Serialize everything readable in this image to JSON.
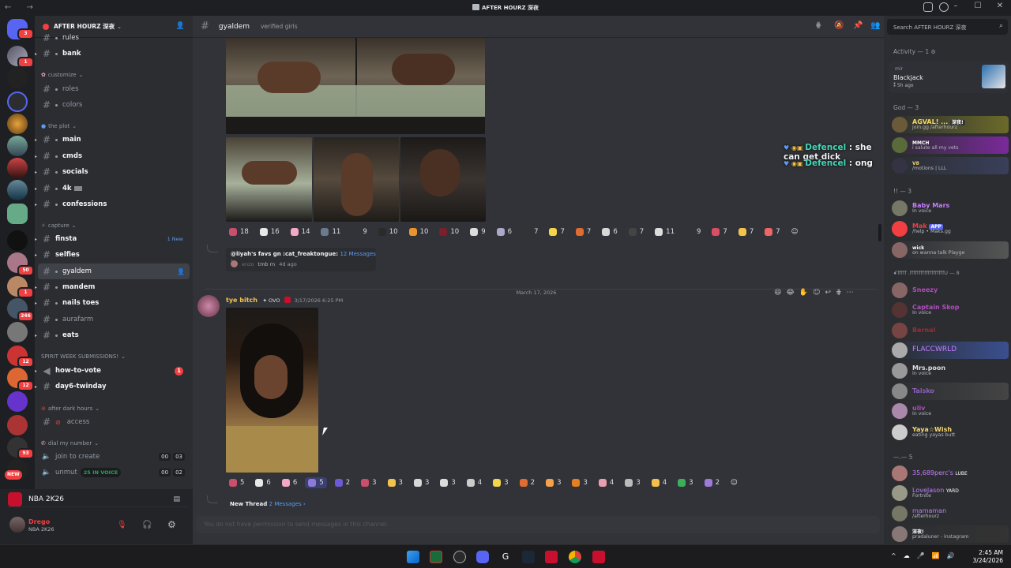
{
  "window": {
    "title": "AFTER HOURZ 深夜"
  },
  "server": {
    "name": "AFTER HOURZ 深夜"
  },
  "search": {
    "placeholder": "Search AFTER HOURZ 深夜"
  },
  "header": {
    "channel": "gyaldem",
    "topic": "verified girls"
  },
  "guild_badges": [
    "3",
    "1",
    "50",
    "1",
    "12",
    "246",
    "12",
    "1",
    "93",
    "1",
    "NEW"
  ],
  "sidebar": {
    "top_partial": "rules",
    "bank": "bank",
    "cat_customize": "customize",
    "roles": "roles",
    "colors": "colors",
    "cat_plot": "the plot",
    "main": "main",
    "cmds": "cmds",
    "socials": "socials",
    "k4": "4k",
    "confessions": "confessions",
    "cat_capture": "capture",
    "finsta": "finsta",
    "finsta_new": "1 New",
    "selfies": "selfies",
    "gyaldem": "gyaldem",
    "mandem": "mandem",
    "nailstoes": "nails toes",
    "aurafarm": "aurafarm",
    "eats": "eats",
    "cat_spirit": "SPIRIT WEEK SUBMISSIONS!",
    "howtovote": "how-to-vote",
    "howtovote_badge": "1",
    "day6": "day6-twinday",
    "cat_afterdark": "after dark hours",
    "access": "access",
    "cat_dial": "dial my number",
    "join": "join to create",
    "join_n1": "00",
    "join_n2": "03",
    "unmute": "unmut",
    "invoice_pill": "25 IN VOICE",
    "unmute_n1": "00",
    "unmute_n2": "02"
  },
  "activity": {
    "game": "NBA 2K26"
  },
  "user": {
    "name": "Drego",
    "status": "NBA 2K26"
  },
  "overlay": [
    {
      "name": "Defencel",
      "text": ": she can get dick"
    },
    {
      "name": "Defencel",
      "text": ": ong"
    }
  ],
  "reactions1": [
    {
      "n": "18",
      "c": "#c94f6d"
    },
    {
      "n": "16",
      "c": "#e8e8e8"
    },
    {
      "n": "14",
      "c": "#f4a7c6"
    },
    {
      "n": "11",
      "c": "#6b7a8f"
    },
    {
      "n": "9",
      "c": "#313338"
    },
    {
      "n": "10",
      "c": "#2b2b2b"
    },
    {
      "n": "10",
      "c": "#e8952e"
    },
    {
      "n": "10",
      "c": "#7a1f2b"
    },
    {
      "n": "9",
      "c": "#dcdcdc"
    },
    {
      "n": "6",
      "c": "#a9a9c9"
    },
    {
      "n": "7",
      "c": "#333"
    },
    {
      "n": "7",
      "c": "#f2d54a"
    },
    {
      "n": "7",
      "c": "#e06c2f"
    },
    {
      "n": "6",
      "c": "#d8d8d8"
    },
    {
      "n": "7",
      "c": "#444"
    },
    {
      "n": "11",
      "c": "#ddd"
    },
    {
      "n": "9",
      "c": "#313338"
    },
    {
      "n": "7",
      "c": "#d94e64"
    },
    {
      "n": "7",
      "c": "#f3c24a"
    },
    {
      "n": "7",
      "c": "#e66"
    }
  ],
  "reactions1_prefix": {
    "n18": "18"
  },
  "thread1": {
    "title": "@liyah's favs gn :cat_freaktongue:",
    "count": "12 Messages ›",
    "preview_user": "enzo",
    "preview_text": "tmb rn",
    "time": "4d ago"
  },
  "divider": "March 17, 2026",
  "message2": {
    "author": "tye bitch",
    "tag": "OVO",
    "timestamp": "3/17/2026 6:25 PM"
  },
  "reactions2": [
    {
      "n": "5",
      "c": "#c94f6d",
      "mine": false
    },
    {
      "n": "6",
      "c": "#e8e8e8",
      "mine": false
    },
    {
      "n": "6",
      "c": "#f4a7c6",
      "mine": false
    },
    {
      "n": "5",
      "c": "#8d7ad9",
      "mine": true
    },
    {
      "n": "2",
      "c": "#6a5ad9",
      "mine": false
    },
    {
      "n": "3",
      "c": "#c94f6d",
      "mine": false
    },
    {
      "n": "3",
      "c": "#f3c24a",
      "mine": false
    },
    {
      "n": "3",
      "c": "#d8d8d8",
      "mine": false
    },
    {
      "n": "3",
      "c": "#dcdcdc",
      "mine": false
    },
    {
      "n": "4",
      "c": "#ccc",
      "mine": false
    },
    {
      "n": "3",
      "c": "#f2d54a",
      "mine": false
    },
    {
      "n": "2",
      "c": "#e06c2f",
      "mine": false
    },
    {
      "n": "3",
      "c": "#f3a14a",
      "mine": false
    },
    {
      "n": "3",
      "c": "#e67e22",
      "mine": false
    },
    {
      "n": "4",
      "c": "#e8a0b0",
      "mine": false
    },
    {
      "n": "3",
      "c": "#bbb",
      "mine": false
    },
    {
      "n": "4",
      "c": "#f3c24a",
      "mine": false
    },
    {
      "n": "3",
      "c": "#3fae5a",
      "mine": false
    },
    {
      "n": "2",
      "c": "#a07ad9",
      "mine": false
    }
  ],
  "thread2": {
    "title": "New Thread",
    "count": "2 Messages ›"
  },
  "composer": {
    "notice": "You do not have permission to send messages in this channel."
  },
  "members": {
    "activity_head": "Activity — 1",
    "activity_user": "mir",
    "activity_game": "Blackjack",
    "activity_time": "5h ago",
    "god_head": "God — 3",
    "god": [
      {
        "name": "AGVAL! ...",
        "status": "join.gg /afterhourz",
        "color": "#f5d76e",
        "tag": "深夜!"
      },
      {
        "name": "",
        "status": "i salute all my vets",
        "color": "#fff",
        "tag": "MMCH"
      },
      {
        "name": "",
        "status": "/motions | LLL",
        "color": "#9aa",
        "tag": "V8"
      }
    ],
    "ii_head": "!! — 3",
    "ii": [
      {
        "name": "Baby Mars",
        "status": "In voice",
        "color": "#c77dff",
        "tag": ""
      },
      {
        "name": "Mak",
        "status": "/help • Maks.gg",
        "color": "#f23f42",
        "tag": "APP"
      },
      {
        "name": "",
        "status": "on wanna talk  Playge",
        "color": "#9aa",
        "tag": "wick"
      }
    ],
    "sq_head": "ꗃ𝖿𝖿𝖿𝖿𝖿  .𝖿𝖿𝖿𝖿𝖿𝖿𝖿𝖿𝖿𝖿𝖿𝖿𝖿𝖿𝖿𝖿𝖿𝖿𝖿U — 8",
    "sq": [
      {
        "name": "Sneezy",
        "status": "",
        "color": "#b04cbd"
      },
      {
        "name": "Captain Skop",
        "status": "In voice",
        "color": "#b04cbd"
      },
      {
        "name": "Bernal",
        "status": "",
        "color": "#9b2d3a"
      },
      {
        "name": "FLACCWRLD",
        "status": "",
        "color": "#c77dff"
      },
      {
        "name": "Mrs.poon",
        "status": "In voice",
        "color": "#dbdee1"
      },
      {
        "name": "Taisko",
        "status": "",
        "color": "#8f5fbf"
      },
      {
        "name": "uliv",
        "status": "In voice",
        "color": "#b04cbd"
      },
      {
        "name": "Yaya☆Wish",
        "status": "eating yayas butt",
        "color": "#f5d76e"
      }
    ],
    "five_head": "—.— 5",
    "five": [
      {
        "name": "35,689perc's",
        "status": "",
        "color": "#c77dff",
        "tag": "LUBE"
      },
      {
        "name": "LoveJason",
        "status": "Fortnite",
        "color": "#c77dff",
        "tag": "YARD"
      },
      {
        "name": "mamaman",
        "status": "/afterhourz",
        "color": "#c77dff",
        "tag": ""
      },
      {
        "name": "",
        "status": "pradaluner - instagram",
        "color": "#dbdee1",
        "tag": "深夜!"
      }
    ]
  },
  "taskbar": {
    "time": "2:45 AM",
    "date": "3/24/2026"
  }
}
